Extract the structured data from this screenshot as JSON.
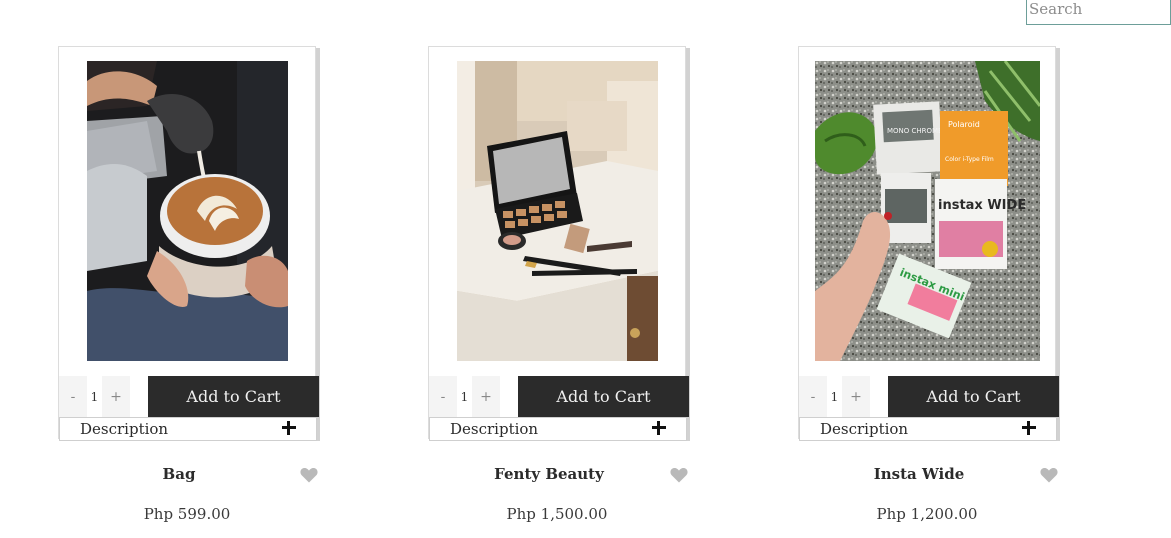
{
  "search": {
    "placeholder": "Search"
  },
  "products": [
    {
      "name": "Bag",
      "price": "Php 599.00",
      "quantity": "1",
      "qty_minus_label": "-",
      "qty_plus_label": "+",
      "add_to_cart_label": "Add to Cart",
      "description_label": "Description"
    },
    {
      "name": "Fenty Beauty",
      "price": "Php 1,500.00",
      "quantity": "1",
      "qty_minus_label": "-",
      "qty_plus_label": "+",
      "add_to_cart_label": "Add to Cart",
      "description_label": "Description"
    },
    {
      "name": "Insta Wide",
      "price": "Php 1,200.00",
      "quantity": "1",
      "qty_minus_label": "-",
      "qty_plus_label": "+",
      "add_to_cart_label": "Add to Cart",
      "description_label": "Description"
    }
  ],
  "photo_labels": {
    "mono_chrome": "MONO CHROME",
    "polaroid": "Polaroid",
    "color_itype": "Color i-Type Film",
    "instax_wide": "instax WIDE",
    "instax_mini": "instax mini"
  },
  "icons": {
    "plus": "plus-icon",
    "heart": "heart-icon"
  },
  "colors": {
    "button_dark": "#2b2b2b",
    "heart_gray": "#b9b9b9",
    "search_border": "#6d9e99"
  }
}
